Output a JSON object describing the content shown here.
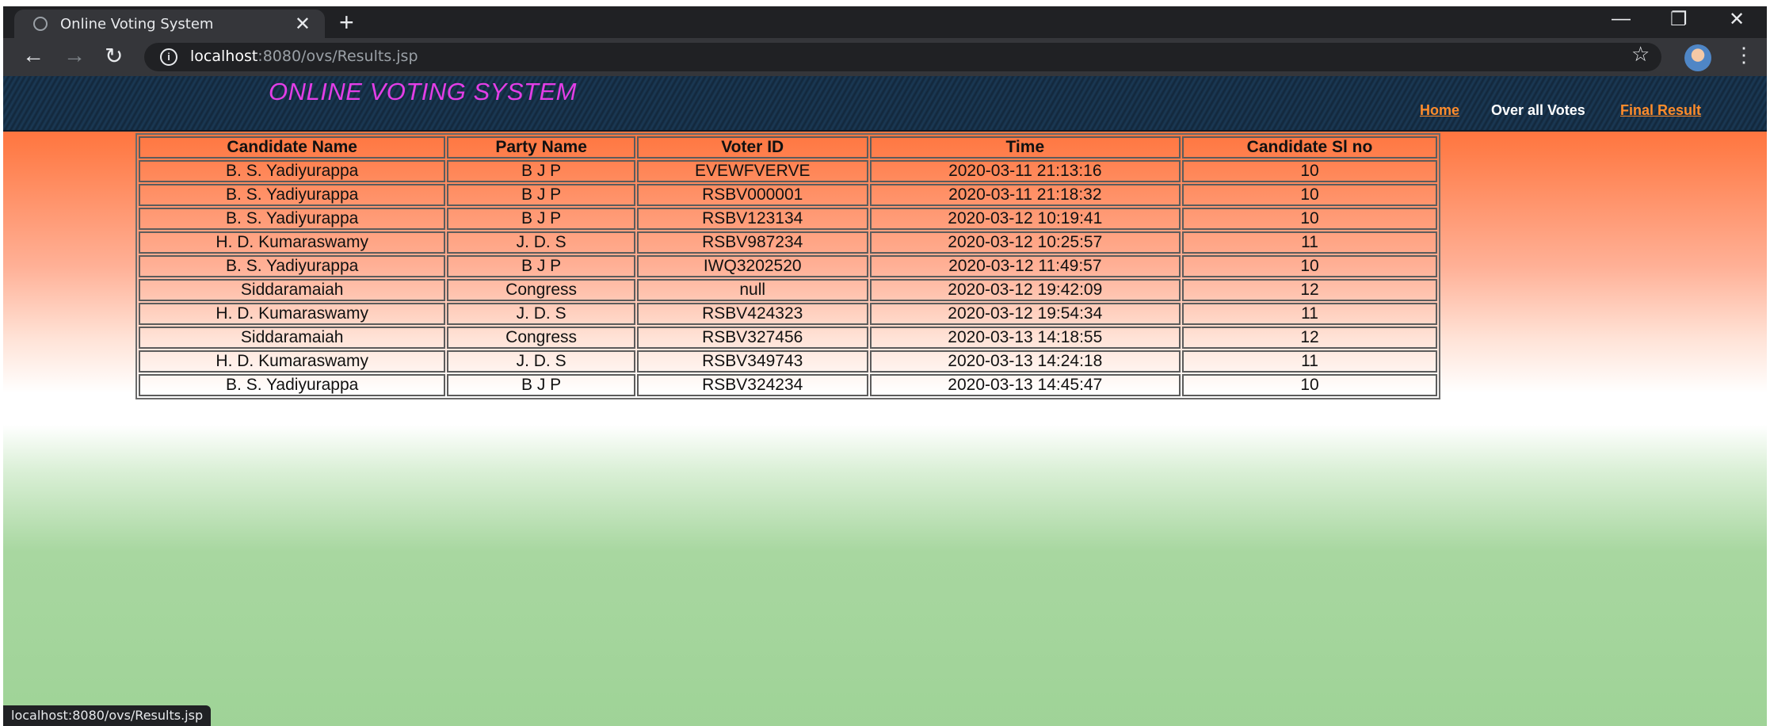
{
  "browser": {
    "tab_title": "Online Voting System",
    "tab_close": "✕",
    "new_tab": "+",
    "url_host": "localhost",
    "url_rest": ":8080/ovs/Results.jsp",
    "status_url": "localhost:8080/ovs/Results.jsp",
    "back": "←",
    "forward": "→",
    "reload": "↻",
    "minimize": "—",
    "maximize": "❐",
    "close": "✕",
    "bookmark": "☆",
    "menu": "⋮",
    "site_info": "i"
  },
  "header": {
    "brand": "ONLINE VOTING SYSTEM",
    "nav": {
      "home": "Home",
      "overall_votes": "Over all Votes",
      "final_result": "Final Result"
    }
  },
  "table": {
    "columns": [
      "Candidate Name",
      "Party Name",
      "Voter ID",
      "Time",
      "Candidate Sl no"
    ],
    "rows": [
      [
        "B. S. Yadiyurappa",
        "B J P",
        "EVEWFVERVE",
        "2020-03-11 21:13:16",
        "10"
      ],
      [
        "B. S. Yadiyurappa",
        "B J P",
        "RSBV000001",
        "2020-03-11 21:18:32",
        "10"
      ],
      [
        "B. S. Yadiyurappa",
        "B J P",
        "RSBV123134",
        "2020-03-12 10:19:41",
        "10"
      ],
      [
        "H. D. Kumaraswamy",
        "J. D. S",
        "RSBV987234",
        "2020-03-12 10:25:57",
        "11"
      ],
      [
        "B. S. Yadiyurappa",
        "B J P",
        "IWQ3202520",
        "2020-03-12 11:49:57",
        "10"
      ],
      [
        "Siddaramaiah",
        "Congress",
        "null",
        "2020-03-12 19:42:09",
        "12"
      ],
      [
        "H. D. Kumaraswamy",
        "J. D. S",
        "RSBV424323",
        "2020-03-12 19:54:34",
        "11"
      ],
      [
        "Siddaramaiah",
        "Congress",
        "RSBV327456",
        "2020-03-13 14:18:55",
        "12"
      ],
      [
        "H. D. Kumaraswamy",
        "J. D. S",
        "RSBV349743",
        "2020-03-13 14:24:18",
        "11"
      ],
      [
        "B. S. Yadiyurappa",
        "B J P",
        "RSBV324234",
        "2020-03-13 14:45:47",
        "10"
      ]
    ]
  },
  "colors": {
    "brand": "#e23ee6",
    "nav_link": "#ff8c2b",
    "header_bg": "#12263a",
    "saffron": "#ff5f25",
    "green": "#9fd397"
  }
}
